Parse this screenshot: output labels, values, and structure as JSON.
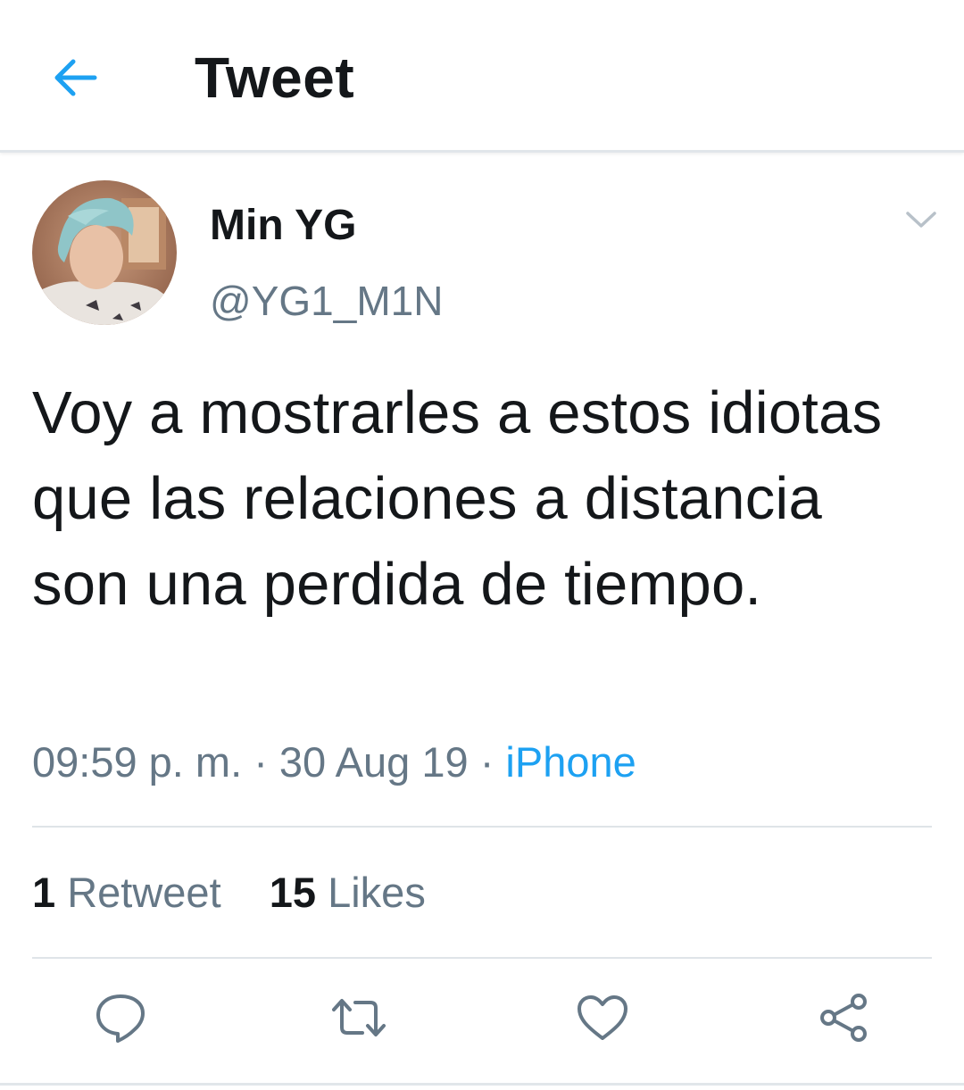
{
  "header": {
    "title": "Tweet",
    "back_icon": "arrow-left-icon",
    "accent_color": "#1da1f2"
  },
  "tweet": {
    "author": {
      "display_name": "Min YG",
      "handle": "@YG1_M1N",
      "avatar_icon": "profile-photo"
    },
    "menu_icon": "chevron-down-icon",
    "text": "Voy a mostrarles a estos idiotas que las relaciones a distancia son una perdida de tiempo.",
    "time": "09:59 p. m.",
    "separator": "·",
    "date": "30 Aug 19",
    "source": "iPhone",
    "stats": {
      "retweets_count": "1",
      "retweets_label": "Retweet",
      "likes_count": "15",
      "likes_label": "Likes"
    },
    "actions": [
      {
        "name": "reply",
        "icon": "reply-bubble-icon"
      },
      {
        "name": "retweet",
        "icon": "retweet-icon"
      },
      {
        "name": "like",
        "icon": "heart-icon"
      },
      {
        "name": "share",
        "icon": "share-icon"
      }
    ]
  },
  "colors": {
    "text_primary": "#14171a",
    "text_secondary": "#657786",
    "link": "#1da1f2",
    "divider": "#dfe4e8"
  }
}
